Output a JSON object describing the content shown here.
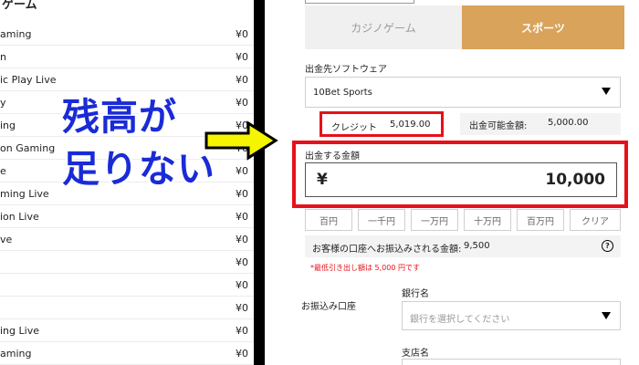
{
  "left": {
    "header": "ゲーム",
    "games": [
      {
        "name": "aming",
        "balance": "¥0"
      },
      {
        "name": "n",
        "balance": "¥0"
      },
      {
        "name": "ic Play Live",
        "balance": "¥0"
      },
      {
        "name": "y",
        "balance": "¥0"
      },
      {
        "name": "ing",
        "balance": "¥0"
      },
      {
        "name": "on Gaming",
        "balance": "¥0"
      },
      {
        "name": "e",
        "balance": "¥0"
      },
      {
        "name": "ming Live",
        "balance": "¥0"
      },
      {
        "name": "ion Live",
        "balance": "¥0"
      },
      {
        "name": "ve",
        "balance": "¥0"
      },
      {
        "name": "",
        "balance": "¥0"
      },
      {
        "name": "",
        "balance": "¥0"
      },
      {
        "name": "",
        "balance": "¥0"
      },
      {
        "name": "ing Live",
        "balance": "¥0"
      },
      {
        "name": "aming",
        "balance": "¥0"
      }
    ]
  },
  "caption": {
    "line1": "残高が",
    "line2": "足りない",
    "color": "#1a2bd6"
  },
  "tabs": {
    "casino": "カジノゲーム",
    "sports": "スポーツ"
  },
  "withdraw": {
    "software_label": "出金先ソフトウェア",
    "software_value": "10Bet Sports",
    "credit_label": "クレジット",
    "credit_value": "5,019.00",
    "available_label": "出金可能金額:",
    "available_value": "5,000.00",
    "amount_label": "出金する金額",
    "currency_symbol": "¥",
    "amount_value": "10,000",
    "quick_amounts": [
      "百円",
      "一千円",
      "一万円",
      "十万円",
      "百万円",
      "クリア"
    ],
    "receive_label": "お客様の口座へお振込みされる金額:",
    "receive_value": "9,500",
    "help": "?",
    "min_note": "*最低引き出し額は 5,000 円です"
  },
  "bank": {
    "section_label": "お振込み口座",
    "bank_name_label": "銀行名",
    "bank_placeholder": "銀行を選択してください",
    "branch_label": "支店名"
  },
  "colors": {
    "accent": "#d9a35b",
    "highlight": "#e8101a",
    "arrow": "#f5f500"
  }
}
